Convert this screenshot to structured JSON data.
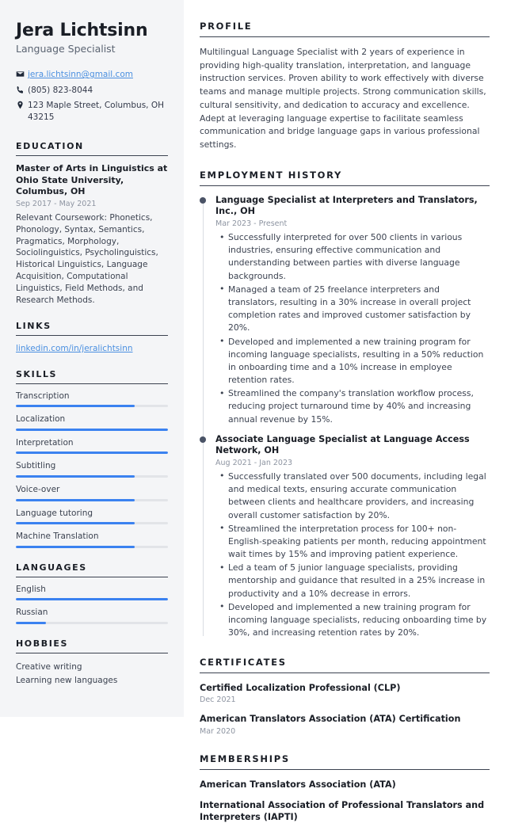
{
  "theme": {
    "accent": "#3b82f0",
    "link": "#4a8fe0",
    "heading": "#1a1e26",
    "muted": "#8d94a1",
    "sidebar_bg": "#f4f5f7"
  },
  "header": {
    "name": "Jera Lichtsinn",
    "title": "Language Specialist",
    "contacts": [
      {
        "icon": "envelope-icon",
        "text": "jera.lichtsinn@gmail.com",
        "is_link": true
      },
      {
        "icon": "phone-icon",
        "text": "(805) 823-8044",
        "is_link": false
      },
      {
        "icon": "location-pin-icon",
        "text": "123 Maple Street, Columbus, OH 43215",
        "is_link": false
      }
    ]
  },
  "sidebar": {
    "education": {
      "heading": "EDUCATION",
      "items": [
        {
          "degree": "Master of Arts in Linguistics at Ohio State University, Columbus, OH",
          "date": "Sep 2017 - May 2021",
          "description": "Relevant Coursework: Phonetics, Phonology, Syntax, Semantics, Pragmatics, Morphology, Sociolinguistics, Psycholinguistics, Historical Linguistics, Language Acquisition, Computational Linguistics, Field Methods, and Research Methods."
        }
      ]
    },
    "links": {
      "heading": "LINKS",
      "items": [
        {
          "label": "linkedin.com/in/jeralichtsinn"
        }
      ]
    },
    "skills": {
      "heading": "SKILLS",
      "items": [
        {
          "label": "Transcription",
          "level": 78
        },
        {
          "label": "Localization",
          "level": 100
        },
        {
          "label": "Interpretation",
          "level": 100
        },
        {
          "label": "Subtitling",
          "level": 78
        },
        {
          "label": "Voice-over",
          "level": 78
        },
        {
          "label": "Language tutoring",
          "level": 78
        },
        {
          "label": "Machine Translation",
          "level": 78
        }
      ]
    },
    "languages": {
      "heading": "LANGUAGES",
      "items": [
        {
          "label": "English",
          "level": 100
        },
        {
          "label": "Russian",
          "level": 20
        }
      ]
    },
    "hobbies": {
      "heading": "HOBBIES",
      "items": [
        {
          "label": "Creative writing"
        },
        {
          "label": "Learning new languages"
        }
      ]
    }
  },
  "main": {
    "profile": {
      "heading": "PROFILE",
      "text": "Multilingual Language Specialist with 2 years of experience in providing high-quality translation, interpretation, and language instruction services. Proven ability to work effectively with diverse teams and manage multiple projects. Strong communication skills, cultural sensitivity, and dedication to accuracy and excellence. Adept at leveraging language expertise to facilitate seamless communication and bridge language gaps in various professional settings."
    },
    "employment": {
      "heading": "EMPLOYMENT HISTORY",
      "jobs": [
        {
          "role": "Language Specialist at Interpreters and Translators, Inc., OH",
          "date": "Mar 2023 - Present",
          "bullets": [
            "Successfully interpreted for over 500 clients in various industries, ensuring effective communication and understanding between parties with diverse language backgrounds.",
            "Managed a team of 25 freelance interpreters and translators, resulting in a 30% increase in overall project completion rates and improved customer satisfaction by 20%.",
            "Developed and implemented a new training program for incoming language specialists, resulting in a 50% reduction in onboarding time and a 10% increase in employee retention rates.",
            "Streamlined the company's translation workflow process, reducing project turnaround time by 40% and increasing annual revenue by 15%."
          ]
        },
        {
          "role": "Associate Language Specialist at Language Access Network, OH",
          "date": "Aug 2021 - Jan 2023",
          "bullets": [
            "Successfully translated over 500 documents, including legal and medical texts, ensuring accurate communication between clients and healthcare providers, and increasing overall customer satisfaction by 20%.",
            "Streamlined the interpretation process for 100+ non-English-speaking patients per month, reducing appointment wait times by 15% and improving patient experience.",
            "Led a team of 5 junior language specialists, providing mentorship and guidance that resulted in a 25% increase in productivity and a 10% decrease in errors.",
            "Developed and implemented a new training program for incoming language specialists, reducing onboarding time by 30%, and increasing retention rates by 20%."
          ]
        }
      ]
    },
    "certificates": {
      "heading": "CERTIFICATES",
      "items": [
        {
          "title": "Certified Localization Professional (CLP)",
          "date": "Dec 2021"
        },
        {
          "title": "American Translators Association (ATA) Certification",
          "date": "Mar 2020"
        }
      ]
    },
    "memberships": {
      "heading": "MEMBERSHIPS",
      "items": [
        {
          "title": "American Translators Association (ATA)"
        },
        {
          "title": "International Association of Professional Translators and Interpreters (IAPTI)"
        }
      ]
    }
  }
}
